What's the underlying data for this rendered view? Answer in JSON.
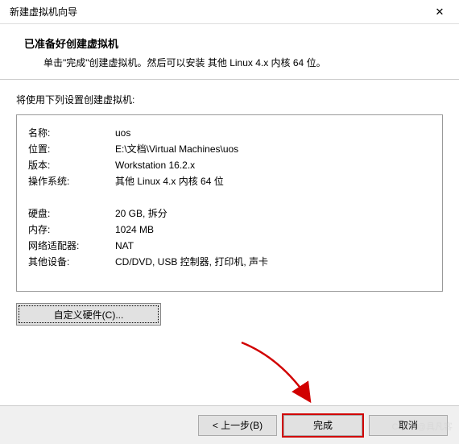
{
  "window": {
    "title": "新建虚拟机向导",
    "close_icon": "✕"
  },
  "header": {
    "heading": "已准备好创建虚拟机",
    "subtext": "单击\"完成\"创建虚拟机。然后可以安装 其他 Linux 4.x 内核 64 位。"
  },
  "body": {
    "intro": "将使用下列设置创建虚拟机:",
    "rows": [
      {
        "label": "名称:",
        "value": "uos"
      },
      {
        "label": "位置:",
        "value": "E:\\文档\\Virtual Machines\\uos"
      },
      {
        "label": "版本:",
        "value": "Workstation 16.2.x"
      },
      {
        "label": "操作系统:",
        "value": "其他 Linux 4.x 内核 64 位"
      }
    ],
    "rows2": [
      {
        "label": "硬盘:",
        "value": "20 GB, 拆分"
      },
      {
        "label": "内存:",
        "value": "1024 MB"
      },
      {
        "label": "网络适配器:",
        "value": "NAT"
      },
      {
        "label": "其他设备:",
        "value": "CD/DVD, USB 控制器, 打印机, 声卡"
      }
    ],
    "customize_label": "自定义硬件(C)..."
  },
  "footer": {
    "back": "< 上一步(B)",
    "finish": "完成",
    "cancel": "取消"
  }
}
